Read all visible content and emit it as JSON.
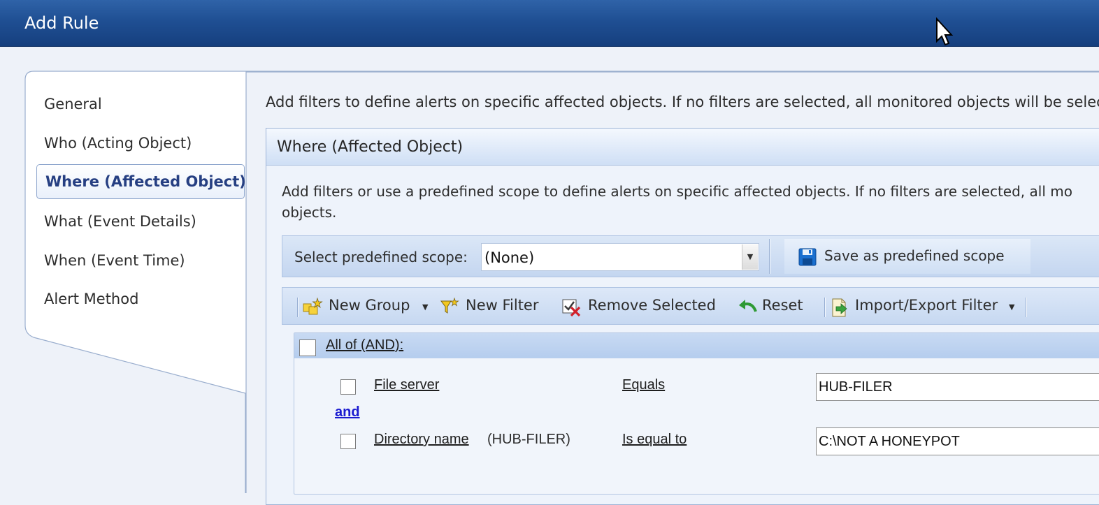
{
  "window": {
    "title": "Add Rule"
  },
  "nav": {
    "items": [
      {
        "label": "General"
      },
      {
        "label": "Who (Acting Object)"
      },
      {
        "label": "Where (Affected Object)"
      },
      {
        "label": "What (Event Details)"
      },
      {
        "label": "When (Event Time)"
      },
      {
        "label": "Alert Method"
      }
    ],
    "selected": "Where (Affected Object)"
  },
  "main": {
    "intro": "Add filters to define alerts on specific affected objects. If no filters are selected, all monitored objects will be select",
    "panel": {
      "title": "Where (Affected Object)",
      "description_line1": "Add filters or use a predefined scope to define alerts on specific affected objects. If no filters are selected, all mo",
      "description_line2": "objects.",
      "scope": {
        "label": "Select predefined scope:",
        "value": "(None)",
        "save_label": "Save as predefined scope"
      },
      "toolbar": {
        "new_group": "New Group",
        "new_filter": "New Filter",
        "remove_selected": "Remove Selected",
        "reset": "Reset",
        "import_export": "Import/Export Filter"
      },
      "group": {
        "label": "All of (AND):",
        "connector": "and",
        "filters": [
          {
            "field": "File server",
            "qualifier": "",
            "operator": "Equals",
            "value": "HUB-FILER"
          },
          {
            "field": "Directory name",
            "qualifier": "(HUB-FILER)",
            "operator": "Is equal to",
            "value": "C:\\NOT A HONEYPOT"
          }
        ]
      }
    }
  },
  "colors": {
    "titlebar": "#1f4f93",
    "selected_nav_text": "#263f82",
    "and_link": "#1b1bd0"
  },
  "icons": [
    "new-group-icon",
    "new-filter-icon",
    "remove-selected-icon",
    "reset-icon",
    "import-export-icon",
    "save-disk-icon",
    "dropdown-arrow-icon",
    "mouse-cursor-icon"
  ]
}
